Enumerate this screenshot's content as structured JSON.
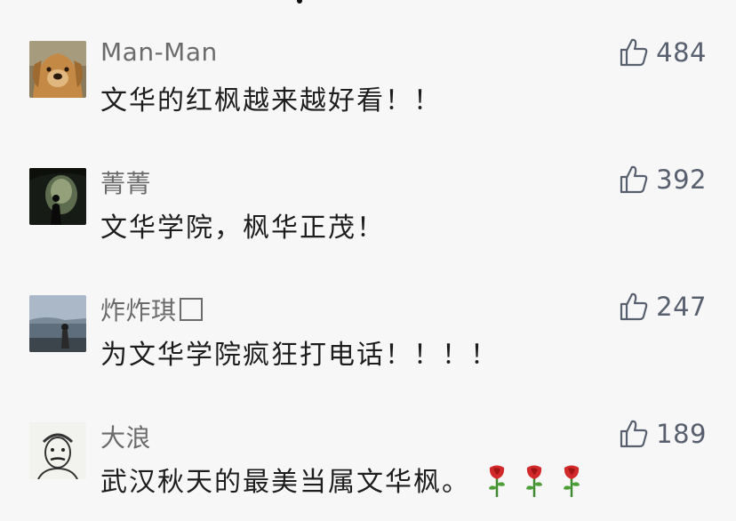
{
  "comments": [
    {
      "name": "Man-Man",
      "text": "文华的红枫越来越好看！！",
      "likes": "484",
      "avatar_icon": "golden-dog-avatar"
    },
    {
      "name": "菁菁",
      "text": "文华学院，枫华正茂！",
      "likes": "392",
      "avatar_icon": "cave-silhouette-avatar"
    },
    {
      "name": "炸炸琪",
      "name_suffix_icon": "unrendered-glyph-box",
      "text": "为文华学院疯狂打电话！！！！",
      "likes": "247",
      "avatar_icon": "lakeside-person-avatar"
    },
    {
      "name": "大浪",
      "text": "武汉秋天的最美当属文华枫。",
      "text_emoji": [
        "rose",
        "rose",
        "rose"
      ],
      "likes": "189",
      "avatar_icon": "sketched-face-avatar"
    }
  ],
  "colors": {
    "background": "#f7f7f7",
    "name": "#6b6b6b",
    "text": "#1d1d1d",
    "like": "#585f6e"
  }
}
